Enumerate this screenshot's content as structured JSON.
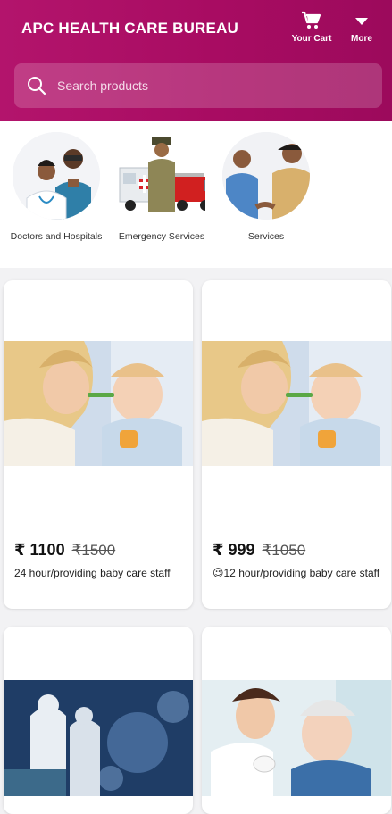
{
  "header": {
    "title": "APC HEALTH CARE BUREAU",
    "cart_label": "Your Cart",
    "more_label": "More",
    "background": "#a80c62"
  },
  "search": {
    "placeholder": "Search products"
  },
  "categories": [
    {
      "label": "Doctors and Hospitals"
    },
    {
      "label": "Emergency Services"
    },
    {
      "label": "Services"
    }
  ],
  "products": [
    {
      "price": "₹ 1100",
      "mrp": "₹1500",
      "description": "24 hour/providing baby care staff"
    },
    {
      "price": "₹ 999",
      "mrp": "₹1050",
      "description": "😉12 hour/providing baby care staff"
    },
    {
      "image": "medical-staff-virus-illustration"
    },
    {
      "image": "nurse-with-elderly-woman"
    }
  ]
}
